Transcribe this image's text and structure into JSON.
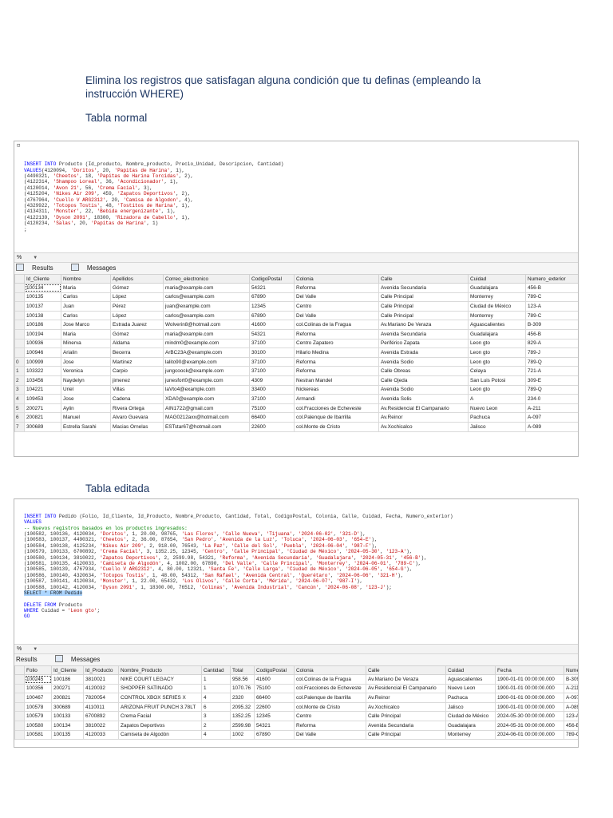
{
  "instruction": "Elimina los registros que satisfagan alguna condición que tu definas (empleando la instrucción WHERE)",
  "heading_normal": "Tabla normal",
  "heading_editada": "Tabla editada",
  "shot1": {
    "code": [
      [
        [
          "kw",
          "INSERT INTO "
        ],
        [
          "txt",
          "Producto (Id_producto, Nombre_producto, Precio_Unidad, Descripcion, Cantidad)"
        ]
      ],
      [
        [
          "kw",
          "VALUES"
        ],
        [
          "txt",
          "(4120094, "
        ],
        [
          "str",
          "'Doritos'"
        ],
        [
          "txt",
          ", 20, "
        ],
        [
          "str",
          "'Papitas de Harina'"
        ],
        [
          "txt",
          ", 1),"
        ]
      ],
      [
        [
          "txt",
          "(4490321, "
        ],
        [
          "str",
          "'Cheetos'"
        ],
        [
          "txt",
          ", 18, "
        ],
        [
          "str",
          "'Papitas de Harina Torcidas'"
        ],
        [
          "txt",
          ", 2),"
        ]
      ],
      [
        [
          "txt",
          "(4122314, "
        ],
        [
          "str",
          "'Shampoo Loreal'"
        ],
        [
          "txt",
          ", 36, "
        ],
        [
          "str",
          "'Acondicionador'"
        ],
        [
          "txt",
          ", 1),"
        ]
      ],
      [
        [
          "txt",
          "(4120014, "
        ],
        [
          "str",
          "'Avon 21'"
        ],
        [
          "txt",
          ", 56, "
        ],
        [
          "str",
          "'Crema Facial'"
        ],
        [
          "txt",
          ", 3),"
        ]
      ],
      [
        [
          "txt",
          "(4125204, "
        ],
        [
          "str",
          "'Nikes Air 209'"
        ],
        [
          "txt",
          ", 459, "
        ],
        [
          "str",
          "'Zapatos Deportivos'"
        ],
        [
          "txt",
          ", 2),"
        ]
      ],
      [
        [
          "txt",
          "(4767964, "
        ],
        [
          "str",
          "'Cuello V ARG2312'"
        ],
        [
          "txt",
          ", 20, "
        ],
        [
          "str",
          "'Camisa de Algodon'"
        ],
        [
          "txt",
          ", 4),"
        ]
      ],
      [
        [
          "txt",
          "(4329922, "
        ],
        [
          "str",
          "'Totopos Tostis'"
        ],
        [
          "txt",
          ", 48, "
        ],
        [
          "str",
          "'Tostitos de Harina'"
        ],
        [
          "txt",
          ", 1),"
        ]
      ],
      [
        [
          "txt",
          "(4134311, "
        ],
        [
          "str",
          "'Monster'"
        ],
        [
          "txt",
          ", 22, "
        ],
        [
          "str",
          "'Bebida energenizante'"
        ],
        [
          "txt",
          ", 1),"
        ]
      ],
      [
        [
          "txt",
          "(4122139, "
        ],
        [
          "str",
          "'Dyson 2091'"
        ],
        [
          "txt",
          ", 18300, "
        ],
        [
          "str",
          "'Rizadora de Cabello'"
        ],
        [
          "txt",
          ", 1),"
        ]
      ],
      [
        [
          "txt",
          "(4120234, "
        ],
        [
          "str",
          "'Salas'"
        ],
        [
          "txt",
          ", 20, "
        ],
        [
          "str",
          "'Papitas de Harina'"
        ],
        [
          "txt",
          ", 1)"
        ]
      ],
      [
        [
          "txt",
          ";"
        ]
      ]
    ],
    "zoom": "%",
    "tab_results": "Results",
    "tab_messages": "Messages",
    "columns": [
      "Id_Cliente",
      "Nombre",
      "Apellidos",
      "Correo_electronico",
      "CodigoPostal",
      "Colonia",
      "Calle",
      "Cuidad",
      "Numero_exterior"
    ],
    "rows": [
      [
        "",
        "100134",
        "Maria",
        "Gómez",
        "maria@example.com",
        "54321",
        "Reforma",
        "Avenida Secundaria",
        "Guadalajara",
        "456-B"
      ],
      [
        "",
        "100135",
        "Carlos",
        "López",
        "carlos@example.com",
        "67890",
        "Del Valle",
        "Calle Principal",
        "Monterrey",
        "789-C"
      ],
      [
        "",
        "100137",
        "Juan",
        "Pérez",
        "juan@example.com",
        "12345",
        "Centro",
        "Calle Principal",
        "Ciudad de México",
        "123-A"
      ],
      [
        "",
        "100138",
        "Carlos",
        "López",
        "carlos@example.com",
        "67890",
        "Del Valle",
        "Calle Principal",
        "Monterrey",
        "789-C"
      ],
      [
        "",
        "100186",
        "Jose Marco",
        "Estrada Juarez",
        "Wolverin8@hotmail.com",
        "41600",
        "col.Colinas de la Fragua",
        "Av.Mariano De Veraza",
        "Aguascalientes",
        "B-309"
      ],
      [
        "",
        "100194",
        "Maria",
        "Gómez",
        "maria@example.com",
        "54321",
        "Reforma",
        "Avenida Secundaria",
        "Guadalajara",
        "456-B"
      ],
      [
        "",
        "100936",
        "Minerva",
        "Aldama",
        "mindm0@example.com",
        "37100",
        "Centro Zapatero",
        "Periférico Zapata",
        "Leon gto",
        "829-A"
      ],
      [
        "",
        "100946",
        "Arialin",
        "Becerra",
        "ArBC23A@example.com",
        "30100",
        "Hilario Medina",
        "Avenida Estrada",
        "Leon gto",
        "789-J"
      ],
      [
        "0",
        "100999",
        "Jose",
        "Martinez",
        "lalito90@example.com",
        "37100",
        "Reforma",
        "Avenida Sodio",
        "Leon gto",
        "789-Q"
      ],
      [
        "1",
        "103322",
        "Veronica",
        "Carpio",
        "jungcoock@example.com",
        "37100",
        "Reforma",
        "Calle Obreas",
        "Celaya",
        "721-A"
      ],
      [
        "2",
        "103456",
        "Naydelyn",
        "jimenez",
        "junesfort0@example.com",
        "4309",
        "Nestran Mandel",
        "Calle Ojeda",
        "San Luis Potosi",
        "309-E"
      ],
      [
        "3",
        "104221",
        "Uriel",
        "Villas",
        "laVto4@example.com",
        "33400",
        "Nickereas",
        "Avenida Sodio",
        "Leon gto",
        "789-Q"
      ],
      [
        "4",
        "109453",
        "Jose",
        "Cadena",
        "XDA0@example.com",
        "37100",
        "Armandi",
        "Avenida Solis",
        "A",
        "234-0"
      ],
      [
        "5",
        "200271",
        "Aylin",
        "Rivera Ortega",
        "AIN1722@gmail.com",
        "75100",
        "col.Fracciones de Echeveste",
        "Av.Residencial El Campanario",
        "Nuevo Leon",
        "A-211"
      ],
      [
        "6",
        "200821",
        "Manuel",
        "Alvaro Guevara",
        "MAG0212axx@hotmail.com",
        "66400",
        "col.Palenque de Ibarrilla",
        "Av.Reinor",
        "Pachuca",
        "A-097"
      ],
      [
        "7",
        "300689",
        "Estrella Sarahi",
        "Macias Ornelas",
        "ESTstar67@hotmail.com",
        "22600",
        "col.Monte de Cristo",
        "Av.Xochicalco",
        "Jalisco",
        "A-089"
      ]
    ]
  },
  "shot2": {
    "code": [
      [
        [
          "kw",
          "INSERT INTO "
        ],
        [
          "txt",
          "Pedido (Folio, Id_Cliente, Id_Producto, Nombre_Producto, Cantidad, Total, CodigoPostal, Colonia, Calle, Cuidad, Fecha, Numero_exterior)"
        ]
      ],
      [
        [
          "kw",
          "VALUES"
        ]
      ],
      [
        [
          "cmt",
          "-- Nuevos registros basados en los productos ingresados:"
        ]
      ],
      [
        [
          "txt",
          "(100582, 100136, 4120034, "
        ],
        [
          "str",
          "'Doritos'"
        ],
        [
          "txt",
          ", 1, 20.00, 98765, "
        ],
        [
          "str",
          "'Las Flores'"
        ],
        [
          "txt",
          ", "
        ],
        [
          "str",
          "'Calle Nueva'"
        ],
        [
          "txt",
          ", "
        ],
        [
          "str",
          "'Tijuana'"
        ],
        [
          "txt",
          ", "
        ],
        [
          "str",
          "'2024-06-02'"
        ],
        [
          "txt",
          ", "
        ],
        [
          "str",
          "'321-D'"
        ],
        [
          "txt",
          "),"
        ]
      ],
      [
        [
          "txt",
          "(100583, 100137, 4490321, "
        ],
        [
          "str",
          "'Cheetos'"
        ],
        [
          "txt",
          ", 2, 36.00, 87654, "
        ],
        [
          "str",
          "'San Pedro'"
        ],
        [
          "txt",
          ", "
        ],
        [
          "str",
          "'Avenida de la Luz'"
        ],
        [
          "txt",
          ", "
        ],
        [
          "str",
          "'Toluca'"
        ],
        [
          "txt",
          ", "
        ],
        [
          "str",
          "'2024-06-03'"
        ],
        [
          "txt",
          ", "
        ],
        [
          "str",
          "'654-E'"
        ],
        [
          "txt",
          "),"
        ]
      ],
      [
        [
          "txt",
          "(100584, 100138, 4125234, "
        ],
        [
          "str",
          "'Nikes Air 209'"
        ],
        [
          "txt",
          ", 2, 918.00, 76543, "
        ],
        [
          "str",
          "'La Paz'"
        ],
        [
          "txt",
          ", "
        ],
        [
          "str",
          "'Calle del Sol'"
        ],
        [
          "txt",
          ", "
        ],
        [
          "str",
          "'Puebla'"
        ],
        [
          "txt",
          ", "
        ],
        [
          "str",
          "'2024-06-04'"
        ],
        [
          "txt",
          ", "
        ],
        [
          "str",
          "'987-F'"
        ],
        [
          "txt",
          "),"
        ]
      ],
      [
        [
          "txt",
          "(100579, 100133, 6700892, "
        ],
        [
          "str",
          "'Crema Facial'"
        ],
        [
          "txt",
          ", 3, 1352.25, 12345, "
        ],
        [
          "str",
          "'Centro'"
        ],
        [
          "txt",
          ", "
        ],
        [
          "str",
          "'Calle Principal'"
        ],
        [
          "txt",
          ", "
        ],
        [
          "str",
          "'Ciudad de México'"
        ],
        [
          "txt",
          ", "
        ],
        [
          "str",
          "'2024-05-30'"
        ],
        [
          "txt",
          ", "
        ],
        [
          "str",
          "'123-A'"
        ],
        [
          "txt",
          "),"
        ]
      ],
      [
        [
          "txt",
          "(100580, 100134, 3810022, "
        ],
        [
          "str",
          "'Zapatos Deportivos'"
        ],
        [
          "txt",
          ", 2, 2599.98, 54321, "
        ],
        [
          "str",
          "'Reforma'"
        ],
        [
          "txt",
          ", "
        ],
        [
          "str",
          "'Avenida Secundaria'"
        ],
        [
          "txt",
          ", "
        ],
        [
          "str",
          "'Guadalajara'"
        ],
        [
          "txt",
          ", "
        ],
        [
          "str",
          "'2024-05-31'"
        ],
        [
          "txt",
          ", "
        ],
        [
          "str",
          "'456-B'"
        ],
        [
          "txt",
          "),"
        ]
      ],
      [
        [
          "txt",
          "(100581, 100135, 4120033, "
        ],
        [
          "str",
          "'Camiseta de Algodón'"
        ],
        [
          "txt",
          ", 4, 1002.00, 67890, "
        ],
        [
          "str",
          "'Del Valle'"
        ],
        [
          "txt",
          ", "
        ],
        [
          "str",
          "'Calle Principal'"
        ],
        [
          "txt",
          ", "
        ],
        [
          "str",
          "'Monterrey'"
        ],
        [
          "txt",
          ", "
        ],
        [
          "str",
          "'2024-06-01'"
        ],
        [
          "txt",
          ", "
        ],
        [
          "str",
          "'789-C'"
        ],
        [
          "txt",
          "),"
        ]
      ],
      [
        [
          "txt",
          "(100585, 100139, 4767934, "
        ],
        [
          "str",
          "'Cuello V ARG2312'"
        ],
        [
          "txt",
          ", 4, 80.00, 12321, "
        ],
        [
          "str",
          "'Santa Fe'"
        ],
        [
          "txt",
          ", "
        ],
        [
          "str",
          "'Calle Larga'"
        ],
        [
          "txt",
          ", "
        ],
        [
          "str",
          "'Ciudad de México'"
        ],
        [
          "txt",
          ", "
        ],
        [
          "str",
          "'2024-06-05'"
        ],
        [
          "txt",
          ", "
        ],
        [
          "str",
          "'654-G'"
        ],
        [
          "txt",
          "),"
        ]
      ],
      [
        [
          "txt",
          "(100586, 100140, 4320634, "
        ],
        [
          "str",
          "'Totopos Tostis'"
        ],
        [
          "txt",
          ", 1, 48.00, 54312, "
        ],
        [
          "str",
          "'San Rafael'"
        ],
        [
          "txt",
          ", "
        ],
        [
          "str",
          "'Avenida Central'"
        ],
        [
          "txt",
          ", "
        ],
        [
          "str",
          "'Querétaro'"
        ],
        [
          "txt",
          ", "
        ],
        [
          "str",
          "'2024-06-06'"
        ],
        [
          "txt",
          ", "
        ],
        [
          "str",
          "'321-H'"
        ],
        [
          "txt",
          "),"
        ]
      ],
      [
        [
          "txt",
          "(100587, 100141, 4120034, "
        ],
        [
          "str",
          "'Monster'"
        ],
        [
          "txt",
          ", 1, 22.00, 65432, "
        ],
        [
          "str",
          "'Los Olivos'"
        ],
        [
          "txt",
          ", "
        ],
        [
          "str",
          "'Calle Corta'"
        ],
        [
          "txt",
          ", "
        ],
        [
          "str",
          "'Mérida'"
        ],
        [
          "txt",
          ", "
        ],
        [
          "str",
          "'2024-06-07'"
        ],
        [
          "txt",
          ", "
        ],
        [
          "str",
          "'987-I'"
        ],
        [
          "txt",
          "),"
        ]
      ],
      [
        [
          "txt",
          "(100588, 100142, 4120034, "
        ],
        [
          "str",
          "'Dyson 2091'"
        ],
        [
          "txt",
          ", 1, 18300.00, 76512, "
        ],
        [
          "str",
          "'Colinas'"
        ],
        [
          "txt",
          ", "
        ],
        [
          "str",
          "'Avenida Industrial'"
        ],
        [
          "txt",
          ", "
        ],
        [
          "str",
          "'Cancún'"
        ],
        [
          "txt",
          ", "
        ],
        [
          "str",
          "'2024-06-08'"
        ],
        [
          "txt",
          ", "
        ],
        [
          "str",
          "'123-J'"
        ],
        [
          "txt",
          ");"
        ]
      ],
      [
        [
          "sel",
          "SELECT * FROM Pedido"
        ]
      ],
      [
        [
          "txt",
          ""
        ]
      ],
      [
        [
          "kw",
          "DELETE FROM "
        ],
        [
          "txt",
          "Producto"
        ]
      ],
      [
        [
          "kw",
          "WHERE "
        ],
        [
          "txt",
          "Cuidad = "
        ],
        [
          "str",
          "'Leon gto'"
        ],
        [
          "txt",
          ";"
        ]
      ],
      [
        [
          "kw",
          "GO"
        ]
      ]
    ],
    "zoom": "%",
    "tab_results": "Results",
    "tab_messages": "Messages",
    "columns": [
      "Folio",
      "Id_Cliente",
      "Id_Producto",
      "Nombre_Producto",
      "Cantidad",
      "Total",
      "CodigoPostal",
      "Colonia",
      "Calle",
      "Cuidad",
      "Fecha",
      "Numero_exterior"
    ],
    "rows": [
      [
        "100245",
        "100186",
        "3810021",
        "NIKE COURT LEGACY",
        "1",
        "958.56",
        "41600",
        "col.Colinas de la Fragua",
        "Av.Mariano De Veraza",
        "Aguascalientes",
        "1900-01-01 00:00:00.000",
        "B-309"
      ],
      [
        "100356",
        "200271",
        "4120032",
        "SHOPPER SATINADO",
        "1",
        "1070.76",
        "75100",
        "col.Fracciones de Echeveste",
        "Av.Residencial El Campanario",
        "Nuevo Leon",
        "1900-01-01 00:00:00.000",
        "A-211"
      ],
      [
        "100467",
        "200821",
        "7820054",
        "CONTROL XBOX SERIES X",
        "4",
        "2320",
        "66400",
        "col.Palenque de Ibarrilla",
        "Av.Reinor",
        "Pachuca",
        "1900-01-01 00:00:00.000",
        "A-097"
      ],
      [
        "100578",
        "300689",
        "4110011",
        "ARIZONA FRUIT PUNCH 3.78LT",
        "6",
        "2095.32",
        "22600",
        "col.Monte de Cristo",
        "Av.Xochicalco",
        "Jalisco",
        "1900-01-01 00:00:00.000",
        "A-089"
      ],
      [
        "100579",
        "100133",
        "6700892",
        "Crema Facial",
        "3",
        "1352.25",
        "12345",
        "Centro",
        "Calle Principal",
        "Ciudad de México",
        "2024-05-30 00:00:00.000",
        "123-A"
      ],
      [
        "100580",
        "100134",
        "3810022",
        "Zapatos Deportivos",
        "2",
        "2599.98",
        "54321",
        "Reforma",
        "Avenida Secundaria",
        "Guadalajara",
        "2024-05-31 00:00:00.000",
        "456-B"
      ],
      [
        "100581",
        "100135",
        "4120033",
        "Camiseta de Algodón",
        "4",
        "1002",
        "67890",
        "Del Valle",
        "Calle Principal",
        "Monterrey",
        "2024-06-01 00:00:00.000",
        "789-C"
      ]
    ]
  }
}
